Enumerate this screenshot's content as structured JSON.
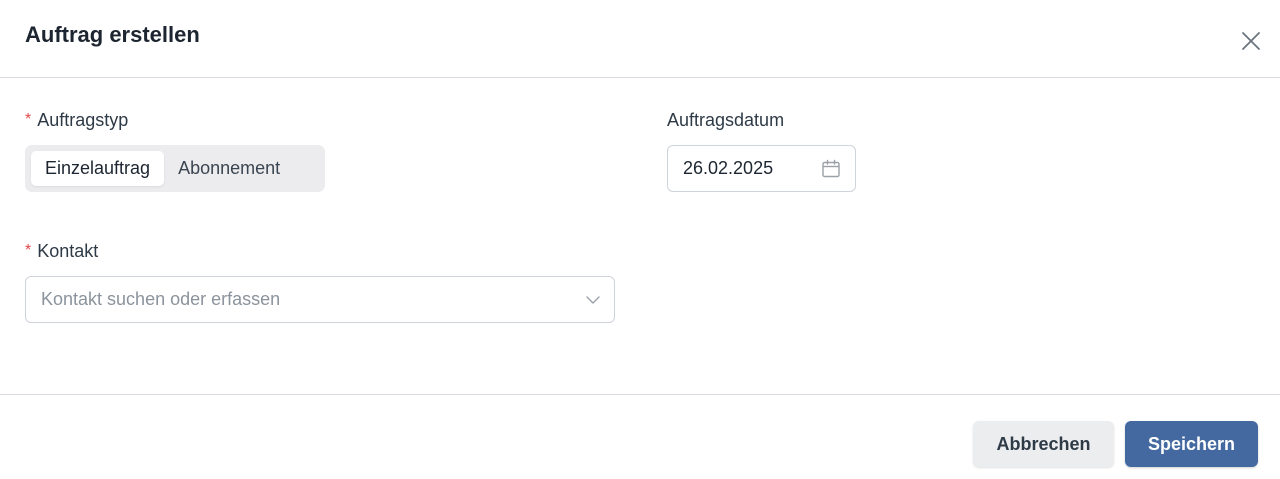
{
  "dialog": {
    "title": "Auftrag erstellen"
  },
  "order_type": {
    "label": "Auftragstyp",
    "required_marker": "*",
    "options": [
      "Einzelauftrag",
      "Abonnement"
    ],
    "selected": "Einzelauftrag"
  },
  "order_date": {
    "label": "Auftragsdatum",
    "value": "26.02.2025"
  },
  "contact": {
    "label": "Kontakt",
    "required_marker": "*",
    "placeholder": "Kontakt suchen oder erfassen"
  },
  "actions": {
    "cancel_label": "Abbrechen",
    "save_label": "Speichern"
  },
  "icons": {
    "close": "close-icon",
    "calendar": "calendar-icon",
    "dropdown": "chevron-down-icon"
  },
  "colors": {
    "primary": "#4468a0",
    "required": "#e0484a",
    "border": "#cfd4da"
  }
}
